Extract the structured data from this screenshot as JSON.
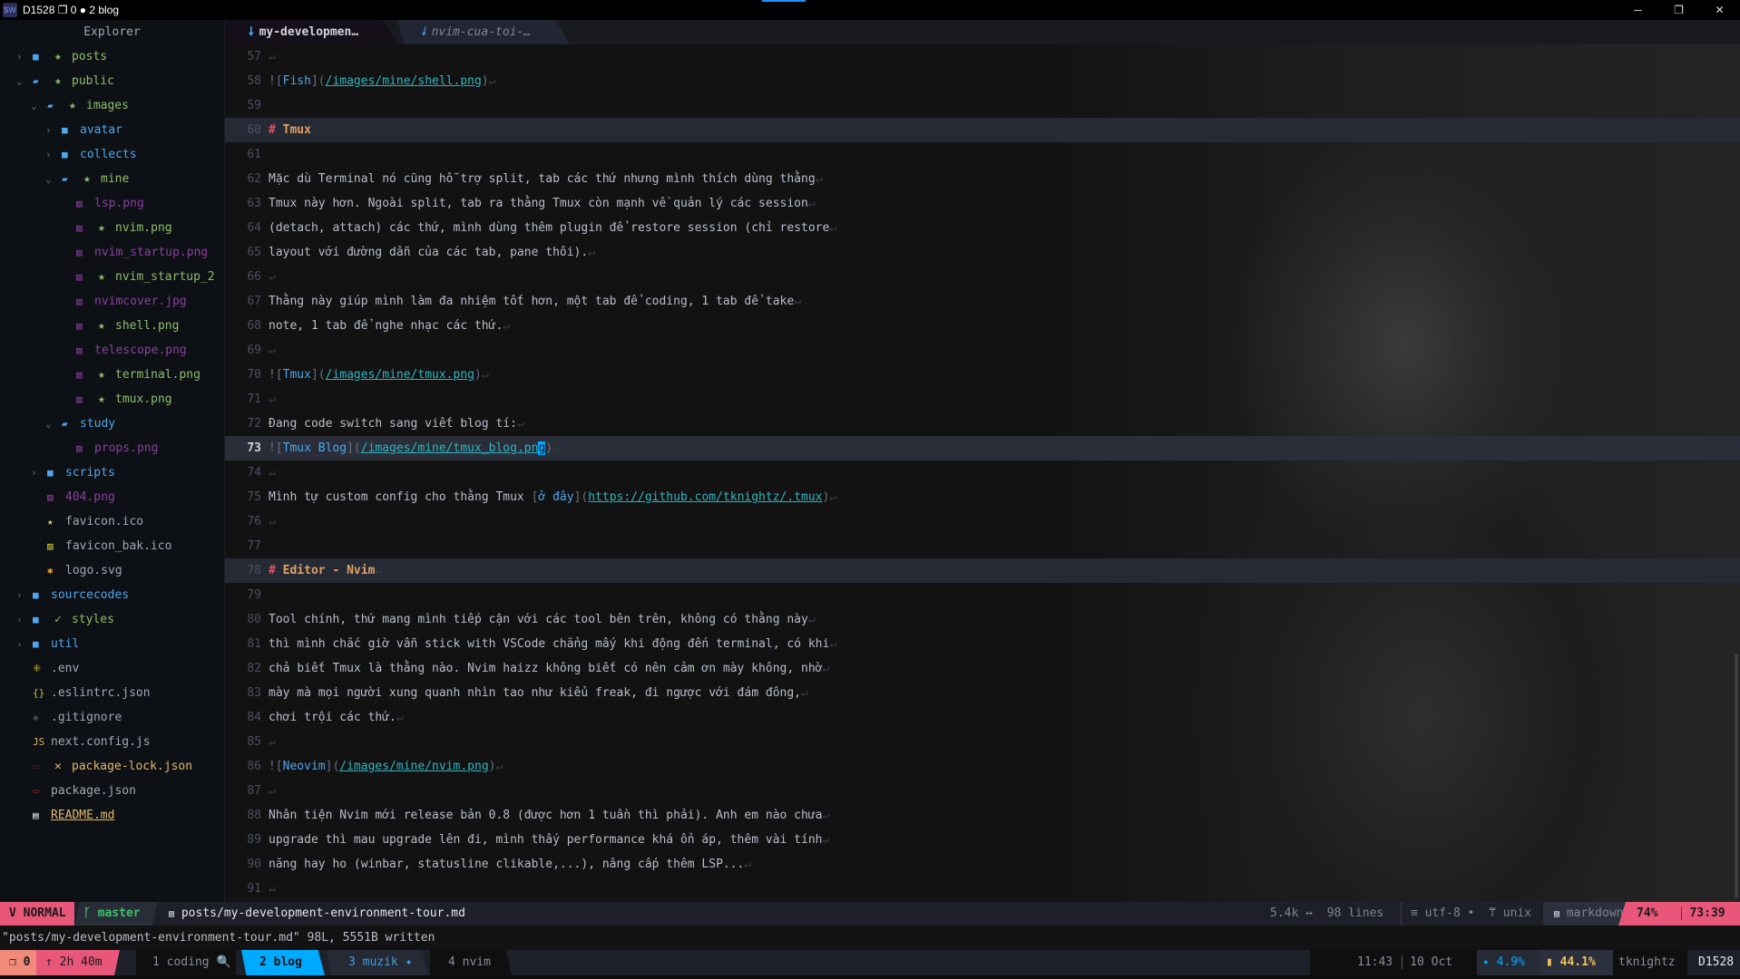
{
  "titlebar": {
    "app_icon": "$W",
    "title": "D1528 ❐ 0 ● 2 blog",
    "minimize": "─",
    "restore": "❐",
    "close": "✕"
  },
  "explorer": {
    "title": "Explorer",
    "items": [
      {
        "depth": 0,
        "chevron": "›",
        "icon": "■",
        "git": "★",
        "name": "posts",
        "kind": "folder-git"
      },
      {
        "depth": 0,
        "chevron": "⌄",
        "icon": "▰",
        "git": "★",
        "name": "public",
        "kind": "folder-git"
      },
      {
        "depth": 1,
        "chevron": "⌄",
        "icon": "▰",
        "git": "★",
        "name": "images",
        "kind": "folder-git"
      },
      {
        "depth": 2,
        "chevron": "›",
        "icon": "■",
        "name": "avatar",
        "kind": "folder"
      },
      {
        "depth": 2,
        "chevron": "›",
        "icon": "■",
        "name": "collects",
        "kind": "folder"
      },
      {
        "depth": 2,
        "chevron": "⌄",
        "icon": "▰",
        "git": "★",
        "name": "mine",
        "kind": "folder-git"
      },
      {
        "depth": 3,
        "icon": "▨",
        "name": "lsp.png",
        "kind": "image"
      },
      {
        "depth": 3,
        "icon": "▨",
        "git": "★",
        "name": "nvim.png",
        "kind": "image-git"
      },
      {
        "depth": 3,
        "icon": "▨",
        "name": "nvim_startup.png",
        "kind": "image"
      },
      {
        "depth": 3,
        "icon": "▨",
        "git": "★",
        "name": "nvim_startup_2",
        "kind": "image-git"
      },
      {
        "depth": 3,
        "icon": "▨",
        "name": "nvimcover.jpg",
        "kind": "image"
      },
      {
        "depth": 3,
        "icon": "▨",
        "git": "★",
        "name": "shell.png",
        "kind": "image-git"
      },
      {
        "depth": 3,
        "icon": "▨",
        "name": "telescope.png",
        "kind": "image"
      },
      {
        "depth": 3,
        "icon": "▨",
        "git": "★",
        "name": "terminal.png",
        "kind": "image-git"
      },
      {
        "depth": 3,
        "icon": "▨",
        "git": "★",
        "name": "tmux.png",
        "kind": "image-git"
      },
      {
        "depth": 2,
        "chevron": "⌄",
        "icon": "▰",
        "name": "study",
        "kind": "folder"
      },
      {
        "depth": 3,
        "icon": "▨",
        "name": "props.png",
        "kind": "image"
      },
      {
        "depth": 1,
        "chevron": "›",
        "icon": "■",
        "name": "scripts",
        "kind": "folder"
      },
      {
        "depth": 1,
        "icon": "▨",
        "name": "404.png",
        "kind": "image"
      },
      {
        "depth": 1,
        "icon": "★",
        "name": "favicon.ico",
        "kind": "file",
        "icon_color": "#d6d24a"
      },
      {
        "depth": 1,
        "icon": "▨",
        "name": "favicon_bak.ico",
        "kind": "file",
        "icon_color": "#c6c23a"
      },
      {
        "depth": 1,
        "icon": "✱",
        "name": "logo.svg",
        "kind": "file",
        "icon_color": "#f0a030"
      },
      {
        "depth": 0,
        "chevron": "›",
        "icon": "■",
        "name": "sourcecodes",
        "kind": "folder"
      },
      {
        "depth": 0,
        "chevron": "›",
        "icon": "■",
        "git": "✓",
        "name": "styles",
        "kind": "folder-git"
      },
      {
        "depth": 0,
        "chevron": "›",
        "icon": "■",
        "name": "util",
        "kind": "folder"
      },
      {
        "depth": 0,
        "icon": "⁜",
        "name": ".env",
        "kind": "file",
        "icon_color": "#c6c23a"
      },
      {
        "depth": 0,
        "icon": "{}",
        "name": ".eslintrc.json",
        "kind": "file",
        "icon_color": "#c6c23a"
      },
      {
        "depth": 0,
        "icon": "◆",
        "name": ".gitignore",
        "kind": "file",
        "icon_color": "#3c4a55"
      },
      {
        "depth": 0,
        "icon": "JS",
        "name": "next.config.js",
        "kind": "file",
        "icon_color": "#d8b070"
      },
      {
        "depth": 0,
        "icon": "▭",
        "git": "✕",
        "name": "package-lock.json",
        "kind": "file-modified",
        "icon_color": "#6a1a24"
      },
      {
        "depth": 0,
        "icon": "▭",
        "name": "package.json",
        "kind": "file",
        "icon_color": "#a02030"
      },
      {
        "depth": 0,
        "icon": "▤",
        "name": "README.md",
        "kind": "readme",
        "icon_color": "#e8e8e8"
      }
    ]
  },
  "tabs": [
    {
      "icon": "🠗",
      "label": "my-developmen…",
      "active": true
    },
    {
      "icon": "🠗",
      "label": "nvim-cua-toi-…",
      "active": false
    }
  ],
  "editor": {
    "eol_symbol": "↵",
    "cursor_line": 73,
    "lines": [
      {
        "n": 57,
        "eol": true,
        "seg": []
      },
      {
        "n": 58,
        "eol": true,
        "seg": [
          [
            "![",
            "p"
          ],
          [
            "Fish",
            "lt"
          ],
          [
            "](",
            "p"
          ],
          [
            "/images/mine/shell.png",
            "u"
          ],
          [
            ")",
            "p"
          ]
        ]
      },
      {
        "n": 59,
        "eol": false,
        "seg": []
      },
      {
        "n": 60,
        "eol": false,
        "heading": true,
        "seg": [
          [
            "# ",
            "h"
          ],
          [
            "Tmux",
            "hd"
          ]
        ]
      },
      {
        "n": 61,
        "eol": false,
        "seg": []
      },
      {
        "n": 62,
        "eol": true,
        "seg": [
          [
            "Mặc dù Terminal nó cũng hỗ trợ split, tab các thứ nhưng mình thích dùng thằng",
            "t"
          ]
        ]
      },
      {
        "n": 63,
        "eol": true,
        "seg": [
          [
            "Tmux này hơn. Ngoài split, tab ra thằng Tmux còn mạnh về quản lý các session",
            "t"
          ]
        ]
      },
      {
        "n": 64,
        "eol": true,
        "seg": [
          [
            "(detach, attach) các thứ, mình dùng thêm plugin để restore session (chỉ restore",
            "t"
          ]
        ]
      },
      {
        "n": 65,
        "eol": true,
        "seg": [
          [
            "layout với đường dẫn của các tab, pane thôi).",
            "t"
          ]
        ]
      },
      {
        "n": 66,
        "eol": true,
        "seg": []
      },
      {
        "n": 67,
        "eol": true,
        "seg": [
          [
            "Thằng này giúp mình làm đa nhiệm tốt hơn, một tab để coding, 1 tab để take",
            "t"
          ]
        ]
      },
      {
        "n": 68,
        "eol": true,
        "seg": [
          [
            "note, 1 tab để nghe nhạc các thứ.",
            "t"
          ]
        ]
      },
      {
        "n": 69,
        "eol": true,
        "seg": []
      },
      {
        "n": 70,
        "eol": true,
        "seg": [
          [
            "![",
            "p"
          ],
          [
            "Tmux",
            "lt"
          ],
          [
            "](",
            "p"
          ],
          [
            "/images/mine/tmux.png",
            "u"
          ],
          [
            ")",
            "p"
          ]
        ]
      },
      {
        "n": 71,
        "eol": true,
        "seg": []
      },
      {
        "n": 72,
        "eol": true,
        "seg": [
          [
            "Đang code switch sang viết blog tí:",
            "t"
          ]
        ]
      },
      {
        "n": 73,
        "eol": true,
        "seg": [
          [
            "![",
            "p"
          ],
          [
            "Tmux Blog",
            "lt"
          ],
          [
            "](",
            "p"
          ],
          [
            "/images/mine/tmux_blog.pn",
            "u"
          ],
          [
            "g",
            "cur"
          ],
          [
            ")",
            "p"
          ]
        ]
      },
      {
        "n": 74,
        "eol": true,
        "seg": []
      },
      {
        "n": 75,
        "eol": true,
        "seg": [
          [
            "Mình tự custom config cho thằng Tmux ",
            "t"
          ],
          [
            "[",
            "p"
          ],
          [
            "ở đây",
            "lt"
          ],
          [
            "](",
            "p"
          ],
          [
            "https://github.com/tknightz/.tmux",
            "u"
          ],
          [
            ")",
            "p"
          ]
        ]
      },
      {
        "n": 76,
        "eol": true,
        "seg": []
      },
      {
        "n": 77,
        "eol": false,
        "seg": []
      },
      {
        "n": 78,
        "eol": true,
        "heading": true,
        "seg": [
          [
            "# ",
            "h"
          ],
          [
            "Editor - Nvim",
            "hd"
          ]
        ]
      },
      {
        "n": 79,
        "eol": false,
        "seg": []
      },
      {
        "n": 80,
        "eol": true,
        "seg": [
          [
            "Tool chính, thứ mang mình tiếp cận với các tool bên trên, không có thằng này",
            "t"
          ]
        ]
      },
      {
        "n": 81,
        "eol": true,
        "seg": [
          [
            "thì mình chắc giờ vẫn stick with VSCode chẳng mấy khi động đến terminal, có khi",
            "t"
          ]
        ]
      },
      {
        "n": 82,
        "eol": true,
        "seg": [
          [
            "chả biết Tmux là thằng nào. Nvim haizz không biết có nên cảm ơn mày không, nhờ",
            "t"
          ]
        ]
      },
      {
        "n": 83,
        "eol": true,
        "seg": [
          [
            "mày mà mọi người xung quanh nhìn tao như kiểu freak, đi ngược với đám đông,",
            "t"
          ]
        ]
      },
      {
        "n": 84,
        "eol": true,
        "seg": [
          [
            "chơi trội các thứ.",
            "t"
          ]
        ]
      },
      {
        "n": 85,
        "eol": true,
        "seg": []
      },
      {
        "n": 86,
        "eol": true,
        "seg": [
          [
            "![",
            "p"
          ],
          [
            "Neovim",
            "lt"
          ],
          [
            "](",
            "p"
          ],
          [
            "/images/mine/nvim.png",
            "u"
          ],
          [
            ")",
            "p"
          ]
        ]
      },
      {
        "n": 87,
        "eol": true,
        "seg": []
      },
      {
        "n": 88,
        "eol": true,
        "seg": [
          [
            "Nhân tiện Nvim mới release bản 0.8 (được hơn 1 tuần thì phải). Anh em nào chưa",
            "t"
          ]
        ]
      },
      {
        "n": 89,
        "eol": true,
        "seg": [
          [
            "upgrade thì mau upgrade lên đi, mình thấy performance khá ổn áp, thêm vài tính",
            "t"
          ]
        ]
      },
      {
        "n": 90,
        "eol": true,
        "seg": [
          [
            "năng hay ho (winbar, statusline clikable,...), nâng cấp thêm LSP...",
            "t"
          ]
        ]
      },
      {
        "n": 91,
        "eol": true,
        "seg": []
      }
    ]
  },
  "statusline": {
    "mode_icon": "V",
    "mode": "NORMAL",
    "branch_icon": "ᚴ",
    "branch": "master",
    "file_icon": "▤",
    "file": "posts/my-development-environment-tour.md",
    "size": "5.4k ↔",
    "lines": "98 lines",
    "encoding": "≡ utf-8 •",
    "format": "⍑ unix",
    "filetype_icon": "▤",
    "filetype": "markdown",
    "percent": "74%",
    "position": "73:39",
    "colors": {
      "mode": "#e8577a",
      "branch": "#3cc46a",
      "accent": "#e8577a"
    }
  },
  "cmdline": "\"posts/my-development-environment-tour.md\" 98L, 5551B written",
  "tmux": {
    "session": "❐ 0",
    "uptime": "↑ 2h 40m",
    "windows": [
      {
        "label": "1 coding 🔍",
        "state": "normal"
      },
      {
        "label": "2 blog",
        "state": "active"
      },
      {
        "label": "3 muzik ✦",
        "state": "last"
      },
      {
        "label": "4 nvim",
        "state": "normal"
      }
    ],
    "time": "11:43",
    "date": "10 Oct",
    "cpu": "✦ 4.9%",
    "mem": "▮ 44.1%",
    "user": "tknightz",
    "host": "D1528",
    "colors": {
      "active": "#00aaff",
      "cpu": "#00aaff",
      "mem": "#f0c060",
      "session": "#f08a7a",
      "uptime": "#e8577a"
    }
  }
}
